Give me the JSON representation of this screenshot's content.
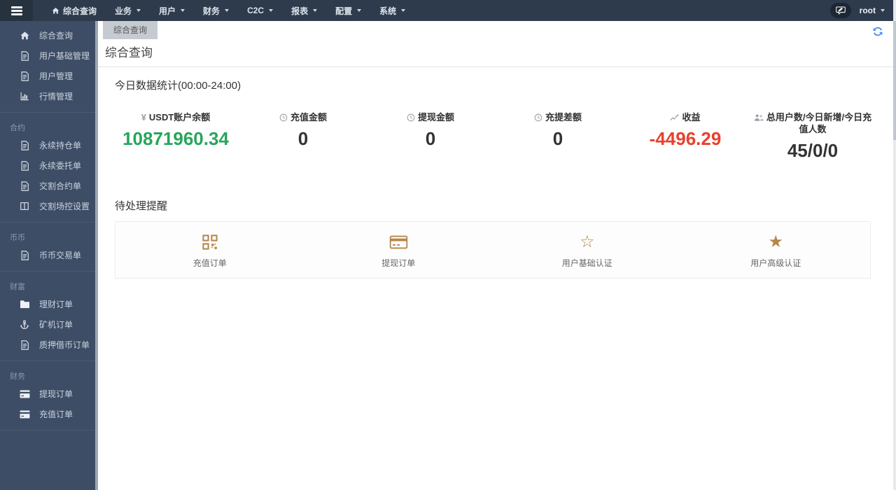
{
  "navbar": {
    "hamburger_icon": "hamburger-icon",
    "home": {
      "icon": "home-icon",
      "label": "综合查询"
    },
    "menus": [
      {
        "label": "业务",
        "icon": "chevron-down-icon"
      },
      {
        "label": "用户",
        "icon": "chevron-down-icon"
      },
      {
        "label": "财务",
        "icon": "chevron-down-icon"
      },
      {
        "label": "C2C",
        "icon": "chevron-down-icon"
      },
      {
        "label": "报表",
        "icon": "chevron-down-icon"
      },
      {
        "label": "配置",
        "icon": "chevron-down-icon"
      },
      {
        "label": "系统",
        "icon": "chevron-down-icon"
      }
    ],
    "chat_icon": "chat-bubble-icon",
    "user": {
      "name": "root",
      "icon": "chevron-down-icon"
    }
  },
  "sidebar": {
    "groups": [
      {
        "title": "",
        "items": [
          {
            "icon": "home-icon",
            "label": "综合查询"
          },
          {
            "icon": "document-icon",
            "label": "用户基础管理"
          },
          {
            "icon": "document-icon",
            "label": "用户管理"
          },
          {
            "icon": "bar-chart-icon",
            "label": "行情管理"
          }
        ]
      },
      {
        "title": "合约",
        "items": [
          {
            "icon": "document-icon",
            "label": "永续持仓单"
          },
          {
            "icon": "document-icon",
            "label": "永续委托单"
          },
          {
            "icon": "document-icon",
            "label": "交割合约单"
          },
          {
            "icon": "columns-icon",
            "label": "交割场控设置"
          }
        ]
      },
      {
        "title": "币币",
        "items": [
          {
            "icon": "document-icon",
            "label": "币币交易单"
          }
        ]
      },
      {
        "title": "财富",
        "items": [
          {
            "icon": "folder-icon",
            "label": "理财订单"
          },
          {
            "icon": "anchor-icon",
            "label": "矿机订单"
          },
          {
            "icon": "document-icon",
            "label": "质押借币订单"
          }
        ]
      },
      {
        "title": "财务",
        "items": [
          {
            "icon": "credit-card-icon",
            "label": "提现订单"
          },
          {
            "icon": "credit-card-icon",
            "label": "充值订单"
          }
        ]
      }
    ]
  },
  "main": {
    "tab": "综合查询",
    "refresh_icon": "refresh-icon",
    "title": "综合查询",
    "stats_heading": "今日数据统计(00:00-24:00)",
    "stats": [
      {
        "icon": "yen-icon",
        "label": "USDT账户余额",
        "value": "10871960.34",
        "color": "#26a65b"
      },
      {
        "icon": "clock-icon",
        "label": "充值金额",
        "value": "0",
        "color": "#333333"
      },
      {
        "icon": "clock-icon",
        "label": "提现金额",
        "value": "0",
        "color": "#333333"
      },
      {
        "icon": "clock-icon",
        "label": "充提差额",
        "value": "0",
        "color": "#333333"
      },
      {
        "icon": "line-chart-icon",
        "label": "收益",
        "value": "-4496.29",
        "color": "#e8412f"
      },
      {
        "icon": "users-icon",
        "label": "总用户数/今日新增/今日充值人数",
        "value": "45/0/0",
        "color": "#333333"
      }
    ],
    "reminders_heading": "待处理提醒",
    "reminders": [
      {
        "icon": "qr-code-icon",
        "label": "充值订单"
      },
      {
        "icon": "credit-card-icon",
        "label": "提现订单"
      },
      {
        "icon": "star-outline-icon",
        "label": "用户基础认证",
        "glyph": "☆"
      },
      {
        "icon": "star-filled-icon",
        "label": "用户高级认证",
        "glyph": "★"
      }
    ]
  },
  "colors": {
    "navbar_bg": "#2d3b4d",
    "sidebar_bg": "#3e4d66",
    "accent_green": "#26a65b",
    "accent_red": "#e8412f",
    "reminder_icon": "#b5874a",
    "refresh_blue": "#4a8af4"
  }
}
